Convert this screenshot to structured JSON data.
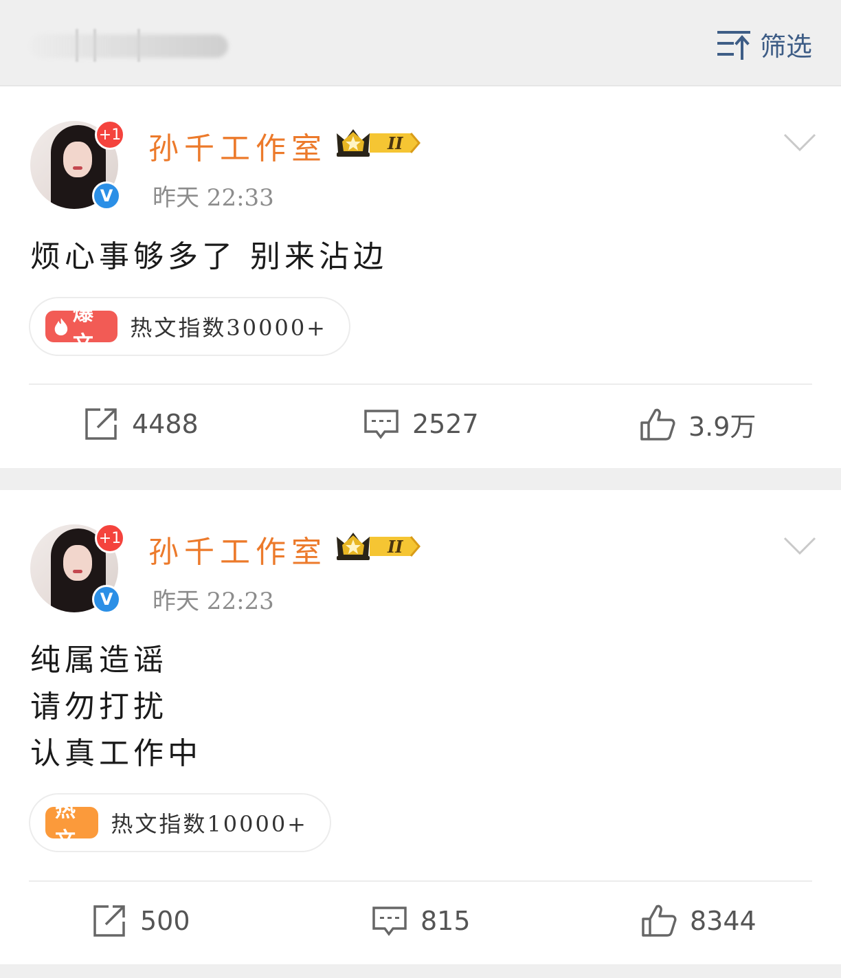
{
  "header": {
    "filter_label": "筛选",
    "filter_icon": "sort-icon"
  },
  "posts": [
    {
      "author": "孙千工作室",
      "avatar_badge": "+1",
      "verified_mark": "V",
      "level_badge": "II",
      "time": "昨天 22:33",
      "content_lines": [
        "烦心事够多了 别来沾边"
      ],
      "hot_tag": "爆文",
      "hot_text": "热文指数30000+",
      "reposts": "4488",
      "comments": "2527",
      "likes": "3.9万"
    },
    {
      "author": "孙千工作室",
      "avatar_badge": "+1",
      "verified_mark": "V",
      "level_badge": "II",
      "time": "昨天 22:23",
      "content_lines": [
        "纯属造谣",
        "请勿打扰",
        "认真工作中"
      ],
      "hot_tag": "热文",
      "hot_text": "热文指数10000+",
      "reposts": "500",
      "comments": "815",
      "likes": "8344"
    }
  ],
  "colors": {
    "author_name": "#ec7a2b",
    "filter_text": "#3e5d86",
    "hot_red": "#f25b55",
    "hot_orange": "#fb9a3b",
    "verified_blue": "#2b8fe6"
  }
}
